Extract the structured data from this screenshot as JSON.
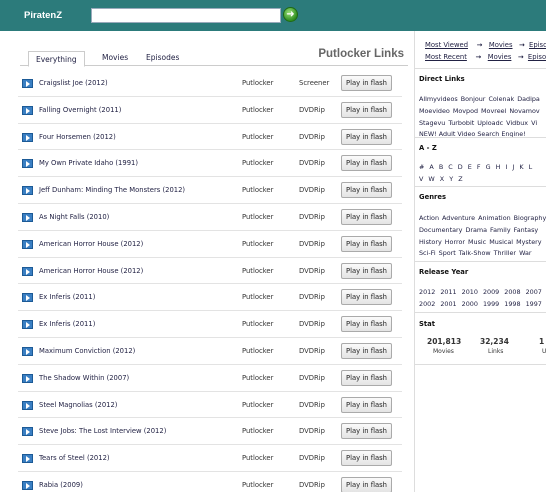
{
  "site": {
    "brand": "PiratenZ",
    "search_placeholder": ""
  },
  "tabs": [
    {
      "label": "Everything",
      "active": true
    },
    {
      "label": "Movies",
      "active": false
    },
    {
      "label": "Episodes",
      "active": false
    }
  ],
  "list_title": "Putlocker Links",
  "rows": [
    {
      "title": "Craigslist Joe (2012)",
      "host": "Putlocker",
      "quality": "Screener",
      "button": "Play in flash"
    },
    {
      "title": "Falling Overnight (2011)",
      "host": "Putlocker",
      "quality": "DVDRip",
      "button": "Play in flash"
    },
    {
      "title": "Four Horsemen (2012)",
      "host": "Putlocker",
      "quality": "DVDRip",
      "button": "Play in flash"
    },
    {
      "title": "My Own Private Idaho (1991)",
      "host": "Putlocker",
      "quality": "DVDRip",
      "button": "Play in flash"
    },
    {
      "title": "Jeff Dunham: Minding The Monsters (2012)",
      "host": "Putlocker",
      "quality": "DVDRip",
      "button": "Play in flash"
    },
    {
      "title": "As Night Falls (2010)",
      "host": "Putlocker",
      "quality": "DVDRip",
      "button": "Play in flash"
    },
    {
      "title": "American Horror House (2012)",
      "host": "Putlocker",
      "quality": "DVDRip",
      "button": "Play in flash"
    },
    {
      "title": "American Horror House (2012)",
      "host": "Putlocker",
      "quality": "DVDRip",
      "button": "Play in flash"
    },
    {
      "title": "Ex Inferis (2011)",
      "host": "Putlocker",
      "quality": "DVDRip",
      "button": "Play in flash"
    },
    {
      "title": "Ex Inferis (2011)",
      "host": "Putlocker",
      "quality": "DVDRip",
      "button": "Play in flash"
    },
    {
      "title": "Maximum Conviction (2012)",
      "host": "Putlocker",
      "quality": "DVDRip",
      "button": "Play in flash"
    },
    {
      "title": "The Shadow Within (2007)",
      "host": "Putlocker",
      "quality": "DVDRip",
      "button": "Play in flash"
    },
    {
      "title": "Steel Magnolias (2012)",
      "host": "Putlocker",
      "quality": "DVDRip",
      "button": "Play in flash"
    },
    {
      "title": "Steve Jobs: The Lost Interview (2012)",
      "host": "Putlocker",
      "quality": "DVDRip",
      "button": "Play in flash"
    },
    {
      "title": "Tears of Steel (2012)",
      "host": "Putlocker",
      "quality": "DVDRip",
      "button": "Play in flash"
    },
    {
      "title": "Rabia (2009)",
      "host": "Putlocker",
      "quality": "DVDRip",
      "button": "Play in flash"
    }
  ],
  "sidebar": {
    "most_viewed": {
      "label": "Most Viewed",
      "arrow": "→",
      "a": "Movies",
      "b": "Episodes"
    },
    "most_recent": {
      "label": "Most Recent",
      "arrow": "→",
      "a": "Movies",
      "b": "Episodes"
    },
    "direct_links_title": "Direct Links",
    "direct_links": [
      [
        "Allmyvideos",
        "Bonjour",
        "Colenak",
        "Dadipa"
      ],
      [
        "Moevideo",
        "Movpod",
        "Movreel",
        "Novamov"
      ],
      [
        "Stagevu",
        "Turbobit",
        "Uploadc",
        "Vidbux",
        "Vi"
      ],
      [
        "NEW! Adult Video Search Engine!"
      ]
    ],
    "az_title": "A - Z",
    "az": [
      [
        "#",
        "A",
        "B",
        "C",
        "D",
        "E",
        "F",
        "G",
        "H",
        "I",
        "J",
        "K",
        "L"
      ],
      [
        "V",
        "W",
        "X",
        "Y",
        "Z"
      ]
    ],
    "genres_title": "Genres",
    "genres": [
      [
        "Action",
        "Adventure",
        "Animation",
        "Biography"
      ],
      [
        "Documentary",
        "Drama",
        "Family",
        "Fantasy"
      ],
      [
        "History",
        "Horror",
        "Music",
        "Musical",
        "Mystery"
      ],
      [
        "Sci-Fi",
        "Sport",
        "Talk-Show",
        "Thriller",
        "War"
      ]
    ],
    "years_title": "Release Year",
    "years": [
      [
        "2012",
        "2011",
        "2010",
        "2009",
        "2008",
        "2007"
      ],
      [
        "2002",
        "2001",
        "2000",
        "1999",
        "1998",
        "1997"
      ]
    ],
    "stat_title": "Stat",
    "stats": [
      {
        "value": "201,813",
        "label": "Movies"
      },
      {
        "value": "32,234",
        "label": "Links"
      },
      {
        "value": "1",
        "label": "U"
      }
    ]
  }
}
